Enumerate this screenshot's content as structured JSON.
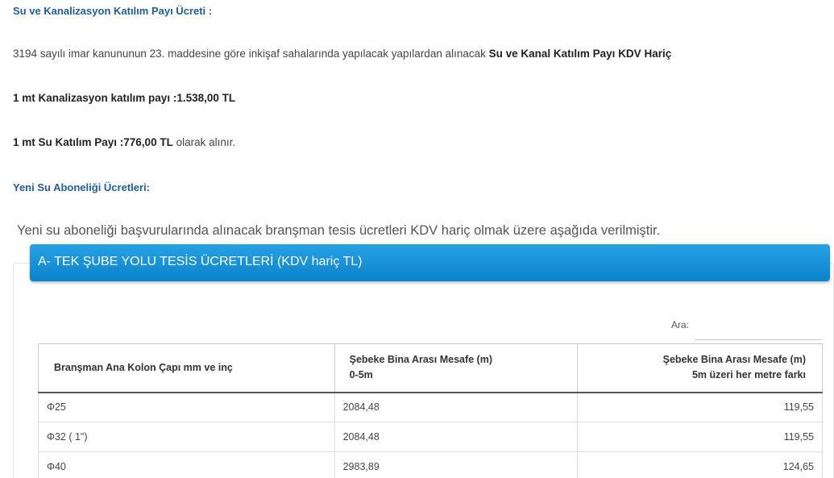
{
  "section1": {
    "title": "Su ve Kanalizasyon Katılım Payı Ücreti :",
    "intro_text": "3194 sayılı imar kanununun 23. maddesine göre inkişaf sahalarında yapılacak yapılardan alınacak ",
    "intro_bold": "Su ve Kanal Katılım Payı KDV Hariç",
    "kanal_text": "1 mt Kanalizasyon katılım payı :1.538,00 TL",
    "su_bold": "1 mt Su Katılım Payı :776,00 TL",
    "su_suffix": " olarak alınır."
  },
  "section2": {
    "title": "Yeni Su Aboneliği Ücretleri:",
    "intro": "Yeni su aboneliği başvurularında alınacak branşman tesis ücretleri KDV hariç olmak üzere aşağıda verilmiştir."
  },
  "panel": {
    "header": "A- TEK ŞUBE YOLU TESİS ÜCRETLERİ (KDV hariç TL)",
    "search_label": "Ara:",
    "search_value": ""
  },
  "table": {
    "headers": {
      "col1": "Branşman Ana Kolon Çapı mm ve inç",
      "col2_line1": "Şebeke Bina Arası Mesafe (m)",
      "col2_line2": "0-5m",
      "col3_line1": "Şebeke Bina Arası Mesafe (m)",
      "col3_line2": "5m üzeri her metre farkı"
    },
    "rows": [
      {
        "cap": "Φ25",
        "mesafe_0_5": "2084,48",
        "metre_farki": "119,55"
      },
      {
        "cap": "Φ32 ( 1\")",
        "mesafe_0_5": "2084,48",
        "metre_farki": "119,55"
      },
      {
        "cap": "Φ40",
        "mesafe_0_5": "2983,89",
        "metre_farki": "124,65"
      }
    ]
  },
  "colors": {
    "heading_blue": "#1d5e9e",
    "panel_header_blue": "#1592dc"
  }
}
